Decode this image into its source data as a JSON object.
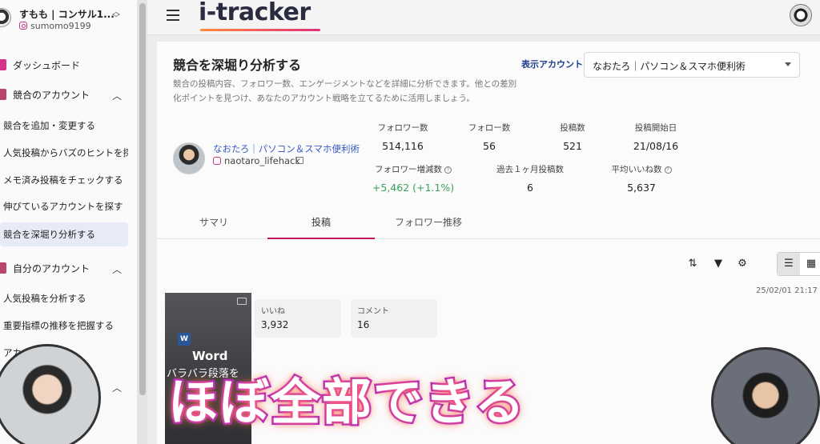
{
  "sidebar": {
    "account_name": "すもも | コンサル1...",
    "account_handle": "sumomo9199",
    "items": {
      "dashboard": "ダッシュボード",
      "competitor_group": "競合のアカウント",
      "add_change": "競合を追加・変更する",
      "viral_hints": "人気投稿からバズのヒントを探す",
      "memo_check": "メモ済み投稿をチェックする",
      "growing": "伸びているアカウントを探す",
      "deep_dive": "競合を深堀り分析する",
      "own_group": "自分のアカウント",
      "analyze_popular": "人気投稿を分析する",
      "kpi_trend": "重要指標の推移を把握する",
      "account_partial": "アカウ     する"
    }
  },
  "topbar": {
    "logo": "i-tracker"
  },
  "main": {
    "title": "競合を深堀り分析する",
    "description": "競合の投稿内容、フォロワー数、エンゲージメントなどを詳細に分析できます。他との差別化ポイントを見つけ、あなたのアカウント戦略を立てるために活用しましょう。",
    "display_account_label": "表示アカウント",
    "display_account_value": "なおたろ｜パソコン＆スマホ便利術",
    "profile": {
      "name": "なおたろ｜パソコン＆スマホ便利術",
      "handle": "naotaro_lifehack"
    },
    "stats": {
      "followers_label": "フォロワー数",
      "followers_value": "514,116",
      "following_label": "フォロー数",
      "following_value": "56",
      "posts_label": "投稿数",
      "posts_value": "521",
      "start_label": "投稿開始日",
      "start_value": "21/08/16",
      "growth_label": "フォロワー増減数",
      "growth_value": "+5,462 (+1.1%)",
      "month_posts_label": "過去１ヶ月投稿数",
      "month_posts_value": "6",
      "avg_likes_label": "平均いいね数",
      "avg_likes_value": "5,637"
    },
    "tabs": [
      "サマリ",
      "投稿",
      "フォロワー推移"
    ],
    "post": {
      "date": "25/02/01 21:17",
      "thumb_title": "Word",
      "thumb_sub": "バラバラ段落を",
      "likes_label": "いいね",
      "likes_value": "3,932",
      "comments_label": "コメント",
      "comments_value": "16"
    }
  },
  "overlay": {
    "caption": "ほぼ全部できる"
  },
  "colors": {
    "accent": "#c2185b",
    "link": "#3a5bbf",
    "positive": "#3aa35a",
    "caption_stroke": "#9b1fd1"
  }
}
